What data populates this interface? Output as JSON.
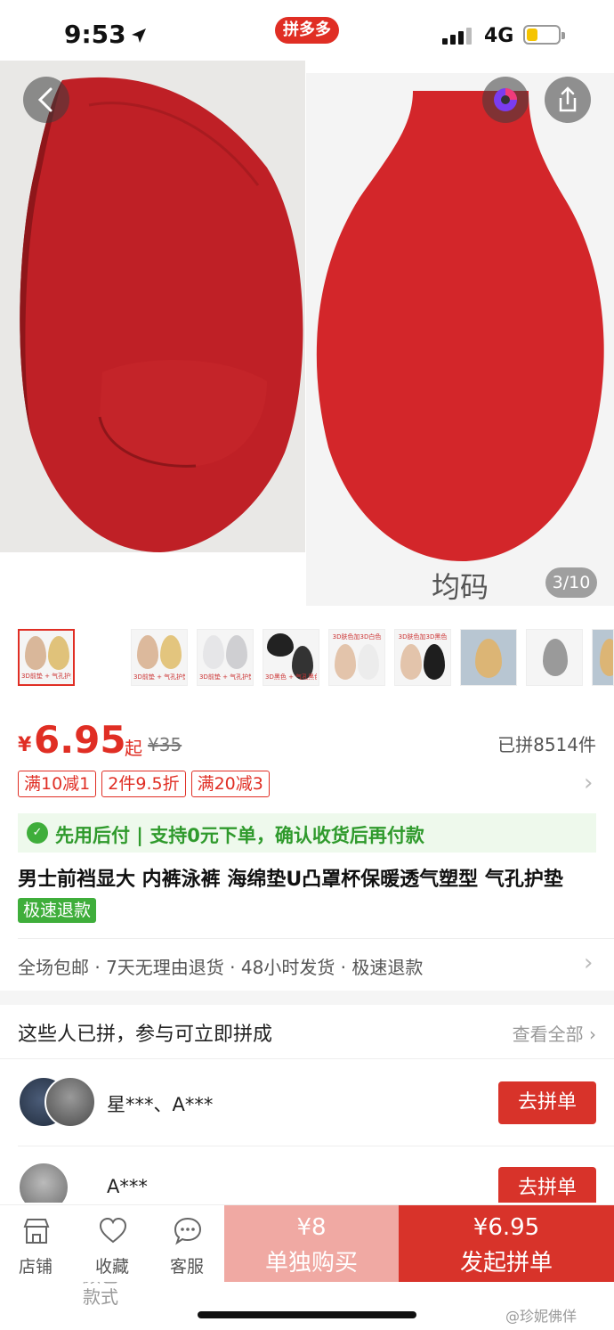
{
  "status_bar": {
    "time": "9:53",
    "network": "4G",
    "app_badge": "拼多多"
  },
  "gallery": {
    "size_label": "均码",
    "page_indicator": "3/10"
  },
  "color_section": {
    "label": "颜色款式"
  },
  "thumbnails": [
    {
      "caption": "3D前垫 + 气孔护垫"
    },
    {
      "caption": "3D前垫 + 气孔护垫"
    },
    {
      "caption": "3D前垫 + 气孔护垫"
    },
    {
      "caption": "3D黑色 + 气孔黑色"
    },
    {
      "caption": "3D肤色加3D白色"
    },
    {
      "caption": "3D肤色加3D黑色"
    },
    {
      "caption": ""
    },
    {
      "caption": ""
    },
    {
      "caption": ""
    }
  ],
  "price": {
    "currency": "¥",
    "value": "6.95",
    "suffix": "起",
    "original": "¥35",
    "sold": "已拼8514件"
  },
  "coupons": [
    "满10减1",
    "2件9.5折",
    "满20减3"
  ],
  "pay_later": {
    "text": "先用后付 | 支持0元下单，确认收货后再付款"
  },
  "product": {
    "title": "男士前裆显大 内裤泳裤 海绵垫U凸罩杯保暖透气塑型 气孔护垫",
    "badge": "极速退款"
  },
  "services": "全场包邮 · 7天无理由退货 · 48小时发货 · 极速退款",
  "group_section": {
    "title": "这些人已拼，参与可立即拼成",
    "see_all": "查看全部",
    "groups": [
      {
        "names": "星***、A***",
        "button": "去拼单"
      },
      {
        "names": "A***",
        "button": "去拼单"
      }
    ]
  },
  "bottom_bar": {
    "store": "店铺",
    "favorite": "收藏",
    "service": "客服",
    "buy_alone_price": "¥8",
    "buy_alone_label": "单独购买",
    "buy_group_price": "¥6.95",
    "buy_group_label": "发起拼单"
  },
  "watermark": "@珍妮佛佯",
  "colors": {
    "accent": "#e02e24",
    "green": "#3fae3b",
    "product_red": "#c8252a"
  }
}
